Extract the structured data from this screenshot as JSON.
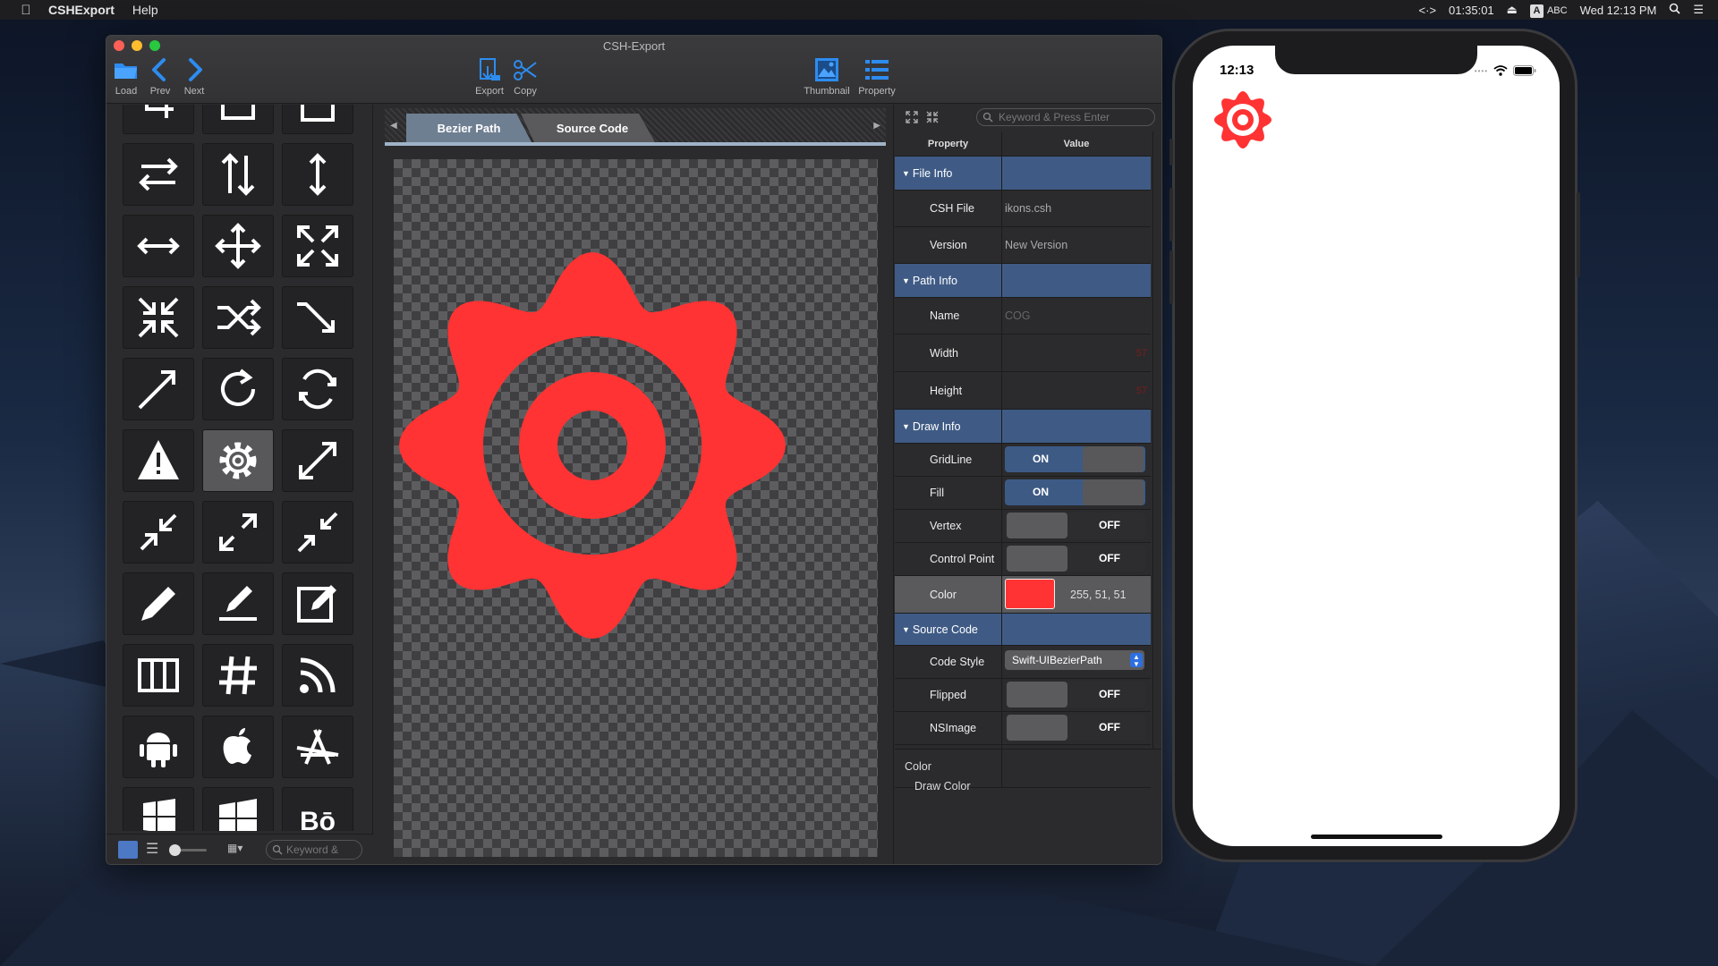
{
  "menubar": {
    "app_name": "CSHExport",
    "menu_help": "Help",
    "clock_elapsed": "01:35:01",
    "input_label": "ABC",
    "input_badge": "A",
    "datetime": "Wed 12:13 PM"
  },
  "window": {
    "title": "CSH-Export",
    "toolbar": {
      "load": "Load",
      "prev": "Prev",
      "next": "Next",
      "export": "Export",
      "copy": "Copy",
      "thumbnail": "Thumbnail",
      "property": "Property"
    }
  },
  "left_panel": {
    "search_placeholder": "Keyword &",
    "icons": [
      "crop-icon",
      "share-icon",
      "clipboard-icon",
      "swap-horizontal-icon",
      "swap-vertical-icon",
      "arrow-up-down-icon",
      "arrow-left-right-icon",
      "move-icon",
      "expand-icon",
      "compress-icon",
      "shuffle-icon",
      "arrow-down-right-icon",
      "arrow-up-right-icon",
      "redo-icon",
      "refresh-icon",
      "warning-icon",
      "gear-icon",
      "resize-diagonal-icon",
      "arrow-in-diagonal-icon",
      "expand-diagonal-icon",
      "collapse-diagonal-icon",
      "pencil-icon",
      "edit-underline-icon",
      "edit-box-icon",
      "columns-icon",
      "hash-icon",
      "rss-icon",
      "android-icon",
      "apple-icon",
      "app-store-icon",
      "windows-icon",
      "windows8-icon",
      "bo-text-icon"
    ],
    "selected_icon": "gear-icon",
    "bottom_text_glyph": "Bō"
  },
  "center_panel": {
    "tabs": [
      "Bezier Path",
      "Source Code"
    ],
    "active_tab": "Bezier Path",
    "preview_color": "#ff3333"
  },
  "property_panel": {
    "search_placeholder": "Keyword & Press Enter",
    "header": {
      "property": "Property",
      "value": "Value"
    },
    "file_info": {
      "group": "File Info",
      "csh_file_label": "CSH File",
      "csh_file_value": "ikons.csh",
      "version_label": "Version",
      "version_value": "New Version"
    },
    "path_info": {
      "group": "Path Info",
      "name_label": "Name",
      "name_value": "COG",
      "width_label": "Width",
      "width_value": "57",
      "height_label": "Height",
      "height_value": "57"
    },
    "draw_info": {
      "group": "Draw Info",
      "gridline_label": "GridLine",
      "gridline_value": "ON",
      "fill_label": "Fill",
      "fill_value": "ON",
      "vertex_label": "Vertex",
      "vertex_value": "OFF",
      "control_point_label": "Control Point",
      "control_point_value": "OFF",
      "color_label": "Color",
      "color_value": "255, 51, 51"
    },
    "source_code": {
      "group": "Source Code",
      "code_style_label": "Code Style",
      "code_style_value": "Swift-UIBezierPath",
      "flipped_label": "Flipped",
      "flipped_value": "OFF",
      "nsimage_label": "NSImage",
      "nsimage_value": "OFF"
    },
    "info": {
      "title": "Color",
      "desc": "Draw Color"
    }
  },
  "phone": {
    "time": "12:13",
    "icon": "gear-icon",
    "icon_color": "#ff3333"
  }
}
